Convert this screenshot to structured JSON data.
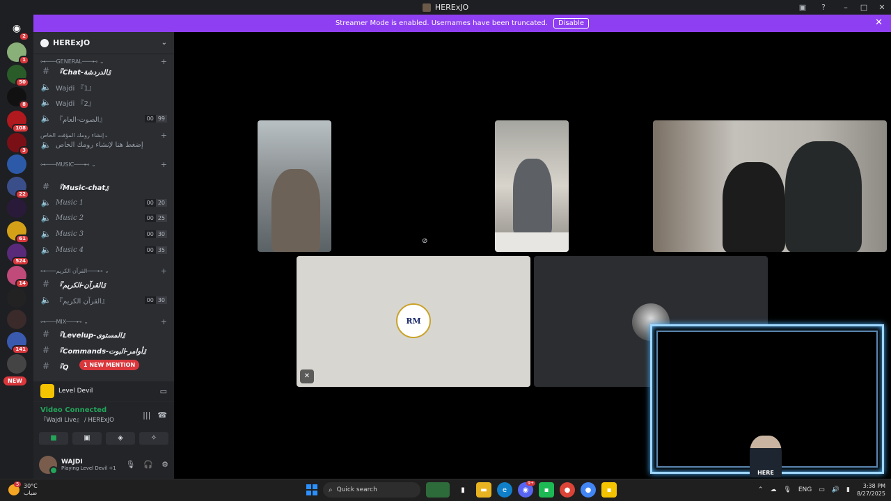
{
  "window": {
    "title": "HERExJO"
  },
  "banner": {
    "text": "Streamer Mode is enabled. Usernames have been truncated.",
    "disable_label": "Disable",
    "color": "#8f3ff2"
  },
  "servers": {
    "badges": [
      "2",
      "1",
      "50",
      "8",
      "108",
      "3",
      "22",
      "61",
      "524",
      "14",
      "141"
    ],
    "new_label": "NEW"
  },
  "server": {
    "name": "HERExJO"
  },
  "categories": {
    "general": "GENERAL",
    "temp": "إنشاء رومك المؤقت الخاص",
    "music": "MUSIC",
    "quran": "القرآن الكريم",
    "mix": "MIX"
  },
  "channels": {
    "chat": "『Chat-الدردشة』",
    "wajdi1": "Wajdi 『1』",
    "wajdi2": "Wajdi 『2』",
    "sound": "『الصوت-العام』",
    "sound_counts": [
      "00",
      "99"
    ],
    "temp_create": "إضغط هنا لإنشاء رومك الخاص",
    "music_chat": "『Music-chat』",
    "music1": "Music 1",
    "music1_counts": [
      "00",
      "20"
    ],
    "music2": "Music 2",
    "music2_counts": [
      "00",
      "25"
    ],
    "music3": "Music 3",
    "music3_counts": [
      "00",
      "30"
    ],
    "music4": "Music 4",
    "music4_counts": [
      "00",
      "35"
    ],
    "quran_text": "『القرآن-الكريم』",
    "quran_voice": "『القرآن الكريم』",
    "quran_counts": [
      "00",
      "30"
    ],
    "levelup": "『Levelup-المستوى』",
    "commands": "『Commands-أوامر-البوت』",
    "q": "『Q",
    "mention": "1 NEW MENTION"
  },
  "activity": {
    "game": "Level Devil"
  },
  "voice": {
    "status": "Video Connected",
    "channel": "『Wajdi Live』",
    "server": "/ HERExJO"
  },
  "user": {
    "name": "WAJDI",
    "activity": "Playing Level Devil",
    "extra": "+1"
  },
  "stage": {
    "crest_text": "RM",
    "overlay_logo": "HERE"
  },
  "taskbar": {
    "temp": "30°C",
    "weather_desc": "ضباب",
    "weather_badge": "5",
    "search_placeholder": "Quick search",
    "lang": "ENG",
    "time": "3:38 PM",
    "date": "8/27/2025",
    "discord_badge": "9+"
  }
}
